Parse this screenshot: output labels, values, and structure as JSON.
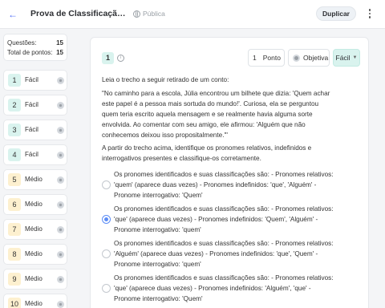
{
  "header": {
    "back_icon": "arrow-left-icon",
    "title": "Prova de Classificação dos...",
    "visibility_icon": "globe-icon",
    "visibility_label": "Pública",
    "duplicate_label": "Duplicar",
    "more_icon": "more-vertical-icon"
  },
  "sidebar": {
    "stats": {
      "questions_label": "Questões:",
      "questions_value": "15",
      "points_label": "Total de pontos:",
      "points_value": "15"
    },
    "questions": [
      {
        "number": "1",
        "difficulty": "Fácil"
      },
      {
        "number": "2",
        "difficulty": "Fácil"
      },
      {
        "number": "3",
        "difficulty": "Fácil"
      },
      {
        "number": "4",
        "difficulty": "Fácil"
      },
      {
        "number": "5",
        "difficulty": "Médio"
      },
      {
        "number": "6",
        "difficulty": "Médio"
      },
      {
        "number": "7",
        "difficulty": "Médio"
      },
      {
        "number": "8",
        "difficulty": "Médio"
      },
      {
        "number": "9",
        "difficulty": "Médio"
      },
      {
        "number": "10",
        "difficulty": "Médio"
      }
    ]
  },
  "question": {
    "number": "1",
    "points_value": "1",
    "points_label": "Ponto",
    "type_label": "Objetiva",
    "difficulty_label": "Fácil",
    "intro": "Leia o trecho a seguir retirado de um conto:",
    "excerpt": "\"No caminho para a escola, Júlia encontrou um bilhete que dizia: 'Quem achar este papel é a pessoa mais sortuda do mundo!'. Curiosa, ela se perguntou quem teria escrito aquela mensagem e se realmente havia alguma sorte envolvida. Ao comentar com seu amigo, ele afirmou: 'Alguém que não conhecemos deixou isso propositalmente.'\"",
    "prompt": "A partir do trecho acima, identifique os pronomes relativos, indefinidos e interrogativos presentes e classifique-os corretamente.",
    "options": [
      {
        "text": "Os pronomes identificados e suas classificações são: - Pronomes relativos: 'quem' (aparece duas vezes) - Pronomes indefinidos: 'que', 'Alguém' - Pronome interrogativo: 'Quem'",
        "selected": false
      },
      {
        "text": "Os pronomes identificados e suas classificações são: - Pronomes relativos: 'que' (aparece duas vezes) - Pronomes indefinidos: 'Quem', 'Alguém' - Pronome interrogativo: 'quem'",
        "selected": true
      },
      {
        "text": "Os pronomes identificados e suas classificações são: - Pronomes relativos: 'Alguém' (aparece duas vezes) - Pronomes indefinidos: 'que', 'Quem' - Pronome interrogativo: 'quem'",
        "selected": false
      },
      {
        "text": "Os pronomes identificados e suas classificações são: - Pronomes relativos: 'que' (aparece duas vezes) - Pronomes indefinidos: 'Alguém', 'que' - Pronome interrogativo: 'Quem'",
        "selected": false
      }
    ]
  },
  "colors": {
    "accent": "#5c8df6",
    "easy_badge": "#d9f3ee",
    "medium_badge": "#fdf0cf"
  }
}
